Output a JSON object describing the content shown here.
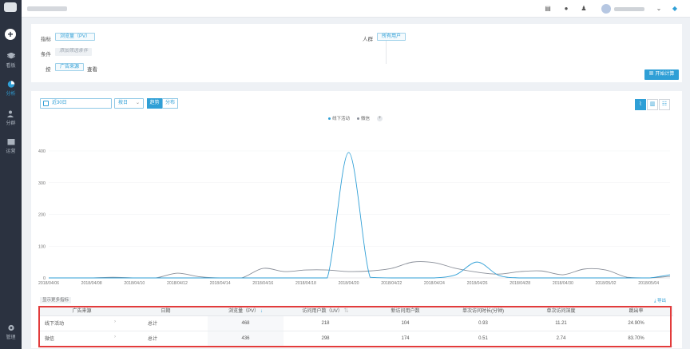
{
  "sidebar": {
    "items": [
      {
        "label": "看板"
      },
      {
        "label": "分析"
      },
      {
        "label": "分群"
      },
      {
        "label": "运营"
      },
      {
        "label": "管理"
      }
    ]
  },
  "filter": {
    "metric_label": "指标",
    "metric_value": "浏览量（PV）",
    "condition_label": "条件",
    "condition_placeholder": "添加筛选条件",
    "by_label": "按",
    "by_value": "广告来源",
    "by_view": "查看",
    "crowd_label": "人群",
    "crowd_value": "所有用户",
    "start_button": "开始计算"
  },
  "controls": {
    "date_range": "近30日",
    "granularity": "按日",
    "trend_toggle": "趋势",
    "distribution_toggle": "分布"
  },
  "colors": {
    "accent": "#2f9fd6",
    "series1": "#2f9fd6",
    "series2": "#8a8f99",
    "highlight": "#e23b3b"
  },
  "chart_data": {
    "type": "line",
    "x": [
      "2018/04/06",
      "2018/04/07",
      "2018/04/08",
      "2018/04/09",
      "2018/04/10",
      "2018/04/11",
      "2018/04/12",
      "2018/04/13",
      "2018/04/14",
      "2018/04/15",
      "2018/04/16",
      "2018/04/17",
      "2018/04/18",
      "2018/04/19",
      "2018/04/20",
      "2018/04/21",
      "2018/04/22",
      "2018/04/23",
      "2018/04/24",
      "2018/04/25",
      "2018/04/26",
      "2018/04/27",
      "2018/04/28",
      "2018/04/29",
      "2018/04/30",
      "2018/05/01",
      "2018/05/02",
      "2018/05/03",
      "2018/05/04",
      "2018/05/05"
    ],
    "x_tick_labels": [
      "2018/04/06",
      "2018/04/08",
      "2018/04/10",
      "2018/04/12",
      "2018/04/14",
      "2018/04/16",
      "2018/04/18",
      "2018/04/20",
      "2018/04/22",
      "2018/04/24",
      "2018/04/26",
      "2018/04/28",
      "2018/04/30",
      "2018/05/02",
      "2018/05/04"
    ],
    "y_ticks": [
      0,
      100,
      200,
      300,
      400
    ],
    "ylim": [
      0,
      400
    ],
    "series": [
      {
        "name": "线下活动",
        "color": "#2f9fd6",
        "values": [
          0,
          0,
          0,
          0,
          0,
          0,
          0,
          0,
          0,
          0,
          0,
          0,
          0,
          0,
          395,
          2,
          0,
          0,
          0,
          10,
          50,
          8,
          0,
          0,
          0,
          0,
          0,
          0,
          0,
          10
        ]
      },
      {
        "name": "微信",
        "color": "#8a8f99",
        "values": [
          0,
          0,
          0,
          2,
          0,
          0,
          15,
          4,
          0,
          0,
          30,
          20,
          25,
          25,
          20,
          22,
          30,
          50,
          48,
          30,
          18,
          12,
          20,
          22,
          10,
          28,
          25,
          2,
          0,
          5
        ]
      }
    ]
  },
  "table": {
    "more_metrics": "显示更多指标",
    "export_label": "导出",
    "headers": [
      "广告来源",
      "日期",
      "浏览量（PV）",
      "访问用户数（UV）",
      "新访问用户数",
      "单次访问时长(分钟)",
      "单次访问深度",
      "跳出率"
    ],
    "rows": [
      [
        "线下活动",
        "总计",
        "468",
        "218",
        "104",
        "0.93",
        "11.21",
        "24.90%"
      ],
      [
        "微信",
        "总计",
        "436",
        "298",
        "174",
        "0.51",
        "2.74",
        "83.70%"
      ]
    ]
  }
}
